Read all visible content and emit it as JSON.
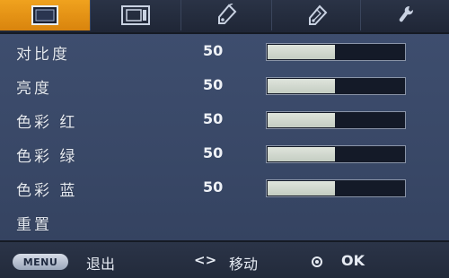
{
  "tabs": [
    {
      "icon": "picture-icon",
      "active": true
    },
    {
      "icon": "screen-display-icon",
      "active": false
    },
    {
      "icon": "setting-tag-icon",
      "active": false
    },
    {
      "icon": "advanced-tag-icon",
      "active": false
    },
    {
      "icon": "wrench-icon",
      "active": false
    }
  ],
  "menu": {
    "items": [
      {
        "label": "对比度",
        "value": "50",
        "level": 0.5
      },
      {
        "label": "亮度",
        "value": "50",
        "level": 0.5
      },
      {
        "label": "色彩 红",
        "value": "50",
        "level": 0.5
      },
      {
        "label": "色彩 绿",
        "value": "50",
        "level": 0.5
      },
      {
        "label": "色彩 蓝",
        "value": "50",
        "level": 0.5
      },
      {
        "label": "重置"
      }
    ]
  },
  "footer": {
    "menu_key": "MENU",
    "exit_label": "退出",
    "move_key": "<>",
    "move_label": "移动",
    "ok_label": "OK"
  },
  "colors": {
    "accent": "#e89518",
    "panel": "#3a4a6a",
    "bar_fill": "#d2d9cf",
    "bar_empty": "#141a28"
  }
}
